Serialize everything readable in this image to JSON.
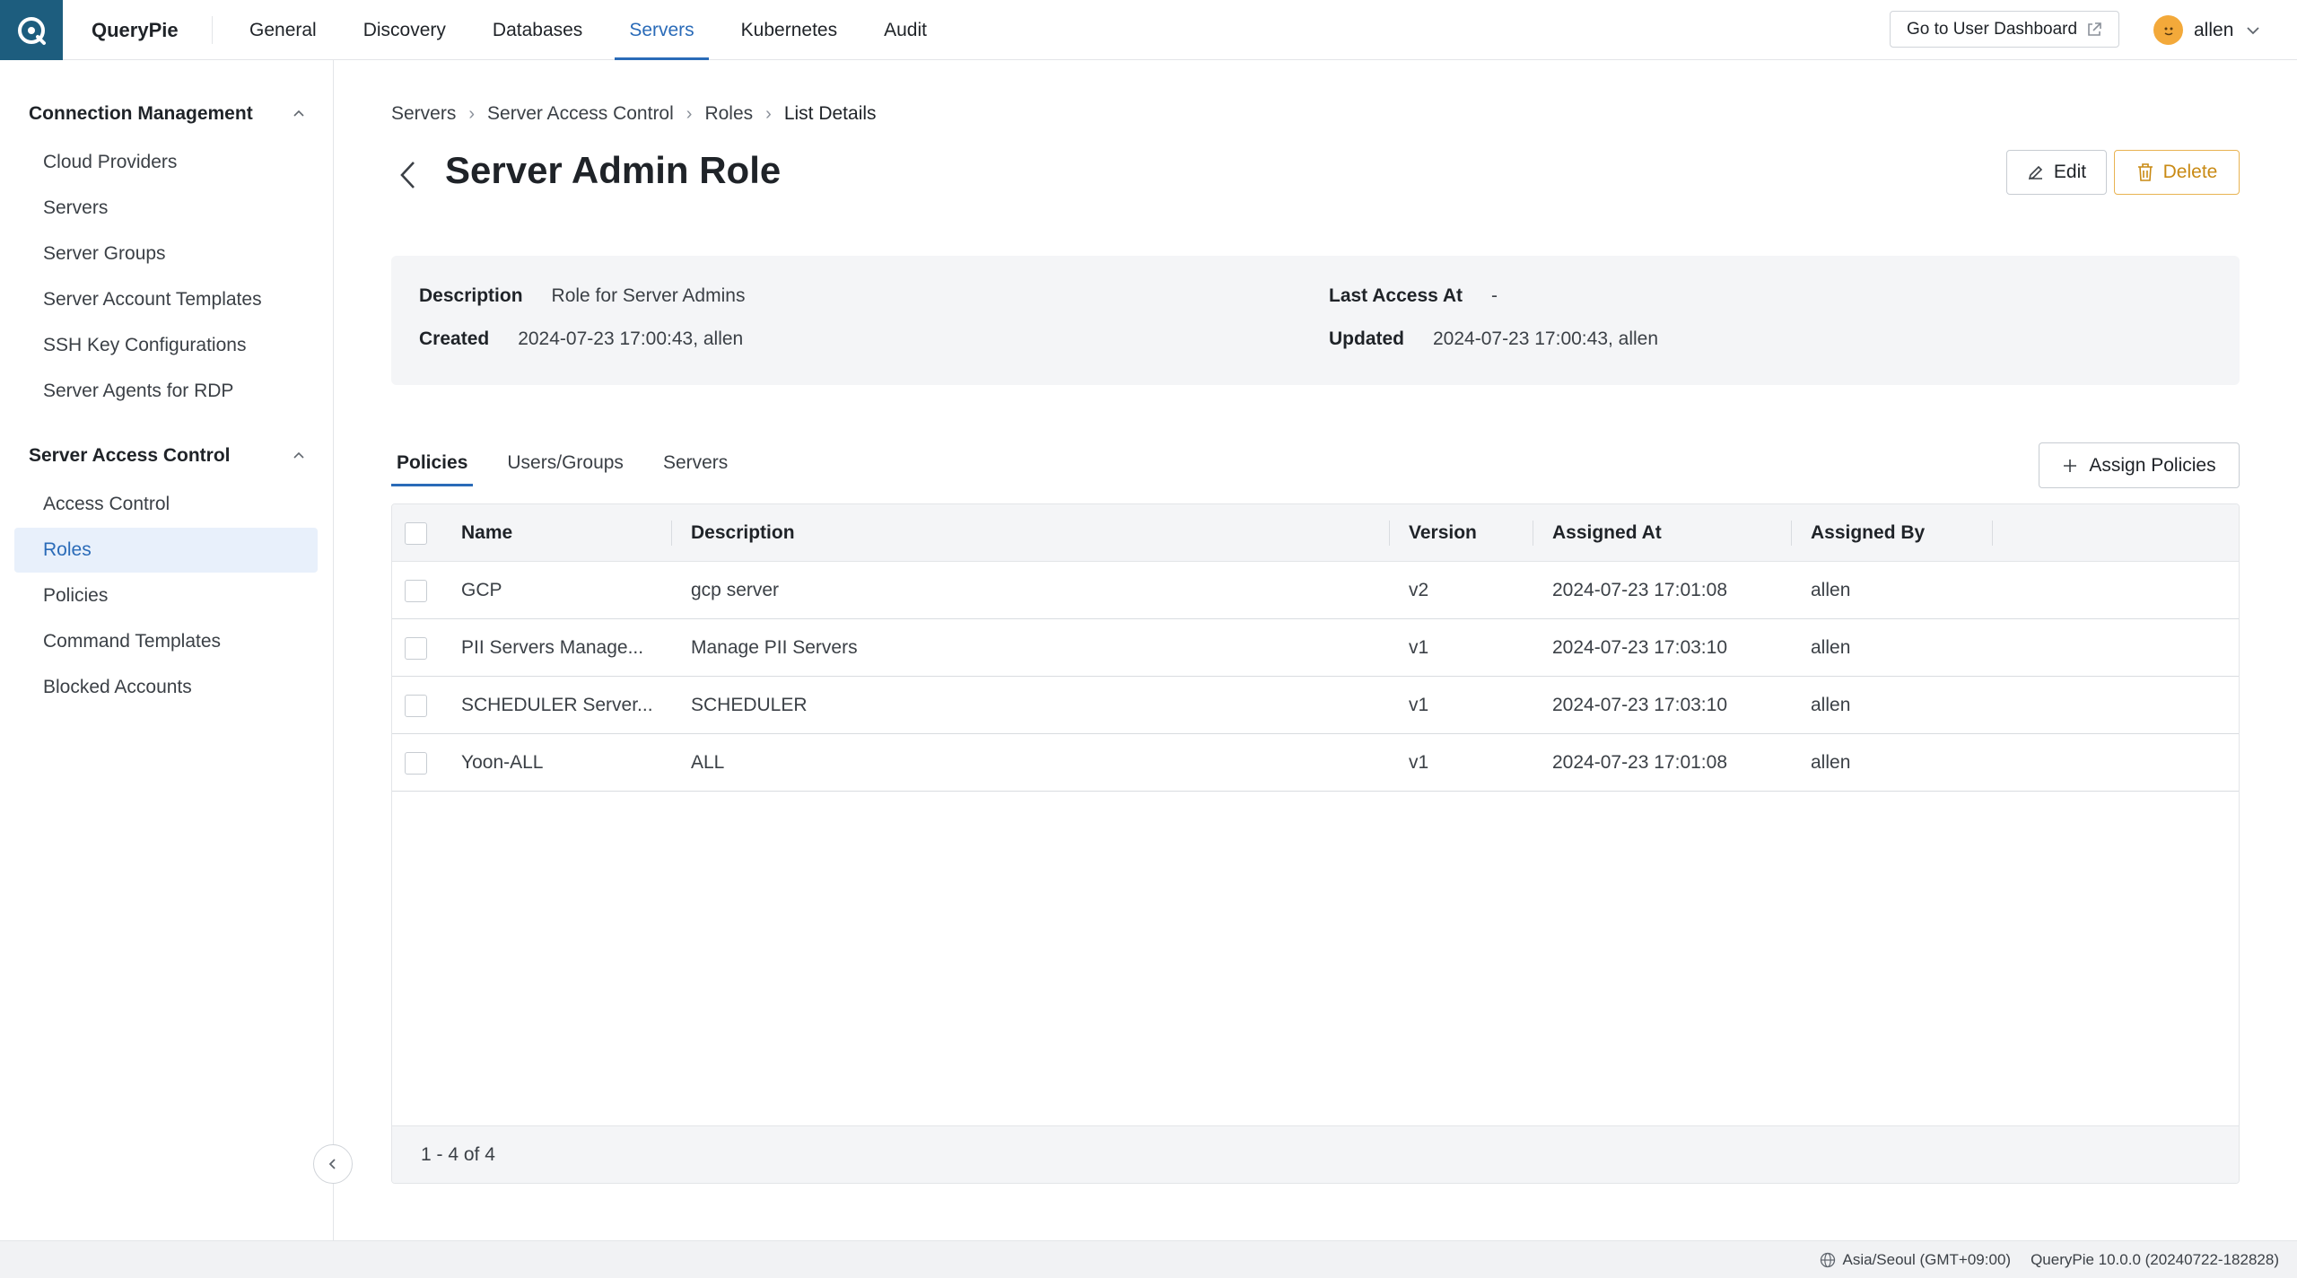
{
  "app": {
    "brand": "QueryPie"
  },
  "nav": {
    "items": [
      {
        "label": "General"
      },
      {
        "label": "Discovery"
      },
      {
        "label": "Databases"
      },
      {
        "label": "Servers",
        "active": true
      },
      {
        "label": "Kubernetes"
      },
      {
        "label": "Audit"
      }
    ],
    "dashboard_button": "Go to User Dashboard",
    "user_name": "allen"
  },
  "sidebar": {
    "section1_title": "Connection Management",
    "section1_items": [
      {
        "label": "Cloud Providers"
      },
      {
        "label": "Servers"
      },
      {
        "label": "Server Groups"
      },
      {
        "label": "Server Account Templates"
      },
      {
        "label": "SSH Key Configurations"
      },
      {
        "label": "Server Agents for RDP"
      }
    ],
    "section2_title": "Server Access Control",
    "section2_items": [
      {
        "label": "Access Control"
      },
      {
        "label": "Roles",
        "active": true
      },
      {
        "label": "Policies"
      },
      {
        "label": "Command Templates"
      },
      {
        "label": "Blocked Accounts"
      }
    ]
  },
  "breadcrumb": [
    "Servers",
    "Server Access Control",
    "Roles",
    "List Details"
  ],
  "page": {
    "title": "Server Admin Role",
    "edit_label": "Edit",
    "delete_label": "Delete"
  },
  "info": {
    "description_label": "Description",
    "description_value": "Role for Server Admins",
    "last_access_label": "Last Access At",
    "last_access_value": "-",
    "created_label": "Created",
    "created_value": "2024-07-23 17:00:43, allen",
    "updated_label": "Updated",
    "updated_value": "2024-07-23 17:00:43, allen"
  },
  "tabs": [
    {
      "label": "Policies",
      "active": true
    },
    {
      "label": "Users/Groups"
    },
    {
      "label": "Servers"
    }
  ],
  "assign_label": "Assign Policies",
  "table": {
    "columns": [
      "Name",
      "Description",
      "Version",
      "Assigned At",
      "Assigned By"
    ],
    "rows": [
      [
        "GCP",
        "gcp server",
        "v2",
        "2024-07-23 17:01:08",
        "allen"
      ],
      [
        "PII Servers Manage...",
        "Manage PII Servers",
        "v1",
        "2024-07-23 17:03:10",
        "allen"
      ],
      [
        "SCHEDULER Server...",
        "SCHEDULER",
        "v1",
        "2024-07-23 17:03:10",
        "allen"
      ],
      [
        "Yoon-ALL",
        "ALL",
        "v1",
        "2024-07-23 17:01:08",
        "allen"
      ]
    ],
    "pagination": "1 - 4 of 4"
  },
  "status": {
    "timezone": "Asia/Seoul (GMT+09:00)",
    "version": "QueryPie 10.0.0 (20240722-182828)"
  },
  "colors": {
    "accent": "#2a6bb8",
    "logo_bg": "#1d5d7e",
    "delete": "#c98a14"
  }
}
